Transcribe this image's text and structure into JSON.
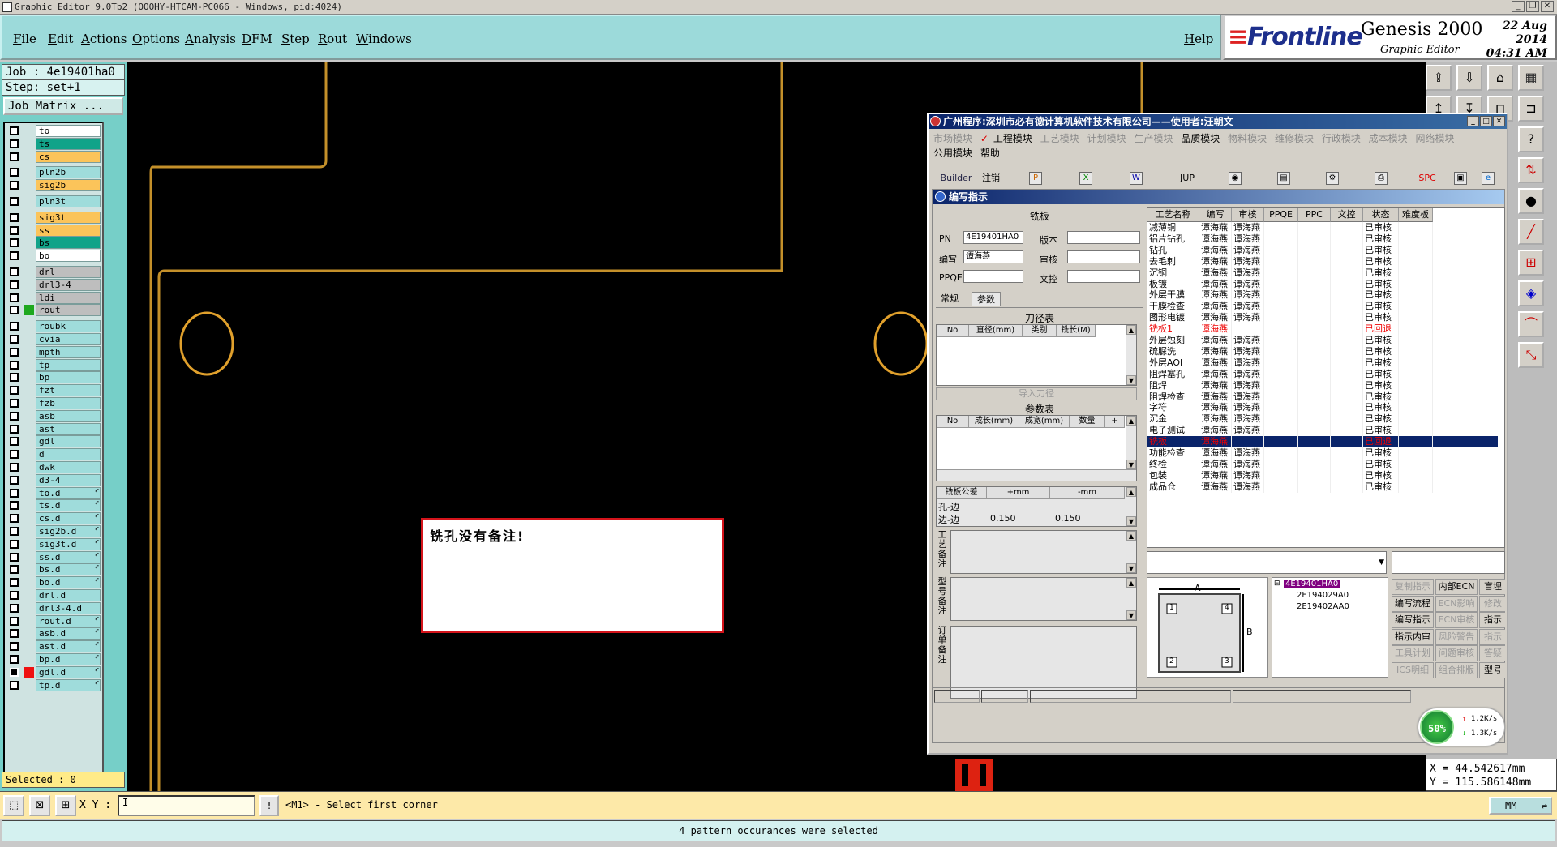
{
  "titlebar": {
    "text": "Graphic Editor 9.0Tb2 (OOOHY-HTCAM-PC066 - Windows, pid:4024)"
  },
  "menu": [
    "File",
    "Edit",
    "Actions",
    "Options",
    "Analysis",
    "DFM",
    "Step",
    "Rout",
    "Windows"
  ],
  "help": "Help",
  "brand": {
    "logo": "Frontline",
    "product": "Genesis 2000",
    "subtitle": "Graphic Editor",
    "date": "22 Aug 2014",
    "time": "04:31 AM"
  },
  "job": {
    "job": "Job : 4e19401ha0",
    "step": "Step: set+1",
    "matrix": "Job Matrix ..."
  },
  "layers": [
    {
      "name": "to",
      "color": "#ffffff"
    },
    {
      "name": "ts",
      "color": "#11a389"
    },
    {
      "name": "cs",
      "color": "#fbc45a"
    },
    {
      "name": "pln2b",
      "color": "#9fdcdb"
    },
    {
      "name": "sig2b",
      "color": "#fbc45a"
    },
    {
      "name": "pln3t",
      "color": "#9fdcdb"
    },
    {
      "name": "sig3t",
      "color": "#fbc45a"
    },
    {
      "name": "ss",
      "color": "#fbc45a"
    },
    {
      "name": "bs",
      "color": "#11a389"
    },
    {
      "name": "bo",
      "color": "#ffffff"
    },
    {
      "name": "drl",
      "color": "#bebebe"
    },
    {
      "name": "drl3-4",
      "color": "#bebebe"
    },
    {
      "name": "ldi",
      "color": "#bebebe"
    },
    {
      "name": "rout",
      "color": "#bebebe",
      "swatch": "#1ea81e"
    },
    {
      "name": "roubk",
      "color": "#9fdcdb"
    },
    {
      "name": "cvia",
      "color": "#9fdcdb"
    },
    {
      "name": "mpth",
      "color": "#9fdcdb"
    },
    {
      "name": "tp",
      "color": "#9fdcdb"
    },
    {
      "name": "bp",
      "color": "#9fdcdb"
    },
    {
      "name": "fzt",
      "color": "#9fdcdb"
    },
    {
      "name": "fzb",
      "color": "#9fdcdb"
    },
    {
      "name": "asb",
      "color": "#9fdcdb"
    },
    {
      "name": "ast",
      "color": "#9fdcdb"
    },
    {
      "name": "gdl",
      "color": "#9fdcdb"
    },
    {
      "name": "d",
      "color": "#9fdcdb"
    },
    {
      "name": "dwk",
      "color": "#9fdcdb"
    },
    {
      "name": "d3-4",
      "color": "#9fdcdb"
    },
    {
      "name": "to.d",
      "color": "#9fdcdb",
      "arrow": true
    },
    {
      "name": "ts.d",
      "color": "#9fdcdb",
      "arrow": true
    },
    {
      "name": "cs.d",
      "color": "#9fdcdb",
      "arrow": true
    },
    {
      "name": "sig2b.d",
      "color": "#9fdcdb",
      "arrow": true
    },
    {
      "name": "sig3t.d",
      "color": "#9fdcdb",
      "arrow": true
    },
    {
      "name": "ss.d",
      "color": "#9fdcdb",
      "arrow": true
    },
    {
      "name": "bs.d",
      "color": "#9fdcdb",
      "arrow": true
    },
    {
      "name": "bo.d",
      "color": "#9fdcdb",
      "arrow": true
    },
    {
      "name": "drl.d",
      "color": "#9fdcdb"
    },
    {
      "name": "drl3-4.d",
      "color": "#9fdcdb"
    },
    {
      "name": "rout.d",
      "color": "#9fdcdb",
      "arrow": true
    },
    {
      "name": "asb.d",
      "color": "#9fdcdb",
      "arrow": true
    },
    {
      "name": "ast.d",
      "color": "#9fdcdb",
      "arrow": true
    },
    {
      "name": "bp.d",
      "color": "#9fdcdb",
      "arrow": true
    },
    {
      "name": "gdl.d",
      "color": "#9fdcdb",
      "arrow": true,
      "swatch": "#e11",
      "checked": true
    },
    {
      "name": "tp.d",
      "color": "#9fdcdb",
      "arrow": true
    }
  ],
  "selected": "Selected : 0",
  "coords": {
    "x": "X = 44.542617mm",
    "y": "Y = 115.586148mm"
  },
  "status": {
    "xy_label": "X Y :",
    "prompt": "<M1> - Select first corner",
    "units": "MM",
    "message": "4 pattern occurances were selected"
  },
  "alert": {
    "text": "铣孔没有备注!"
  },
  "cnapp": {
    "title": "广州程序:深圳市必有德计算机软件技术有限公司——使用者:汪朝文",
    "modules": [
      "市场模块",
      "工程模块",
      "工艺模块",
      "计划模块",
      "生产模块",
      "品质模块",
      "物料模块",
      "维修模块",
      "行政模块",
      "成本模块",
      "网络模块"
    ],
    "modules2": [
      "公用模块",
      "帮助"
    ],
    "toolbar": [
      "Builder",
      "注销",
      "JUP",
      "SPC"
    ],
    "inner_title": "编写指示",
    "form": {
      "header": "铣板",
      "pn_label": "PN",
      "pn": "4E19401HA0",
      "version_label": "版本",
      "author_label": "编写",
      "author": "谭海燕",
      "review_label": "审核",
      "ppqe_label": "PPQE",
      "control_label": "文控",
      "tabs": [
        "常规",
        "参数"
      ],
      "tool_header": "刀径表",
      "tool_cols": [
        "No",
        "直径(mm)",
        "类别",
        "铣长(M)"
      ],
      "import_btn": "导入刀径",
      "param_header": "参数表",
      "param_cols": [
        "No",
        "成长(mm)",
        "成宽(mm)",
        "数量",
        "+"
      ],
      "tol_cols": [
        "铣板公差",
        "+mm",
        "-mm"
      ],
      "tol_rows": [
        {
          "name": "孔-边",
          "plus": "",
          "minus": ""
        },
        {
          "name": "边-边",
          "plus": "0.150",
          "minus": "0.150"
        }
      ],
      "note_labels": [
        "工艺备注",
        "型号备注",
        "订单备注"
      ]
    },
    "proc_cols": [
      "工艺名称",
      "编写",
      "审核",
      "PPQE",
      "PPC",
      "文控",
      "状态",
      "难度板"
    ],
    "proc_rows": [
      {
        "n": "减薄铜",
        "w": "谭海燕",
        "r": "谭海燕",
        "s": "已审核"
      },
      {
        "n": "铝片钻孔",
        "w": "谭海燕",
        "r": "谭海燕",
        "s": "已审核"
      },
      {
        "n": "钻孔",
        "w": "谭海燕",
        "r": "谭海燕",
        "s": "已审核"
      },
      {
        "n": "去毛刺",
        "w": "谭海燕",
        "r": "谭海燕",
        "s": "已审核"
      },
      {
        "n": "沉铜",
        "w": "谭海燕",
        "r": "谭海燕",
        "s": "已审核"
      },
      {
        "n": "板镀",
        "w": "谭海燕",
        "r": "谭海燕",
        "s": "已审核"
      },
      {
        "n": "外层干膜",
        "w": "谭海燕",
        "r": "谭海燕",
        "s": "已审核"
      },
      {
        "n": "干膜检查",
        "w": "谭海燕",
        "r": "谭海燕",
        "s": "已审核"
      },
      {
        "n": "图形电镀",
        "w": "谭海燕",
        "r": "谭海燕",
        "s": "已审核"
      },
      {
        "n": "铣板1",
        "w": "谭海燕",
        "r": "",
        "s": "已回退",
        "t": "red"
      },
      {
        "n": "外层蚀刻",
        "w": "谭海燕",
        "r": "谭海燕",
        "s": "已审核"
      },
      {
        "n": "硫脲洗",
        "w": "谭海燕",
        "r": "谭海燕",
        "s": "已审核"
      },
      {
        "n": "外层AOI",
        "w": "谭海燕",
        "r": "谭海燕",
        "s": "已审核"
      },
      {
        "n": "阻焊塞孔",
        "w": "谭海燕",
        "r": "谭海燕",
        "s": "已审核"
      },
      {
        "n": "阻焊",
        "w": "谭海燕",
        "r": "谭海燕",
        "s": "已审核"
      },
      {
        "n": "阻焊检查",
        "w": "谭海燕",
        "r": "谭海燕",
        "s": "已审核"
      },
      {
        "n": "字符",
        "w": "谭海燕",
        "r": "谭海燕",
        "s": "已审核"
      },
      {
        "n": "沉金",
        "w": "谭海燕",
        "r": "谭海燕",
        "s": "已审核"
      },
      {
        "n": "电子测试",
        "w": "谭海燕",
        "r": "谭海燕",
        "s": "已审核"
      },
      {
        "n": "铣板",
        "w": "谭海燕",
        "r": "",
        "s": "已回退",
        "t": "sel"
      },
      {
        "n": "功能检查",
        "w": "谭海燕",
        "r": "谭海燕",
        "s": "已审核"
      },
      {
        "n": "终检",
        "w": "谭海燕",
        "r": "谭海燕",
        "s": "已审核"
      },
      {
        "n": "包装",
        "w": "谭海燕",
        "r": "谭海燕",
        "s": "已审核"
      },
      {
        "n": "成品仓",
        "w": "谭海燕",
        "r": "谭海燕",
        "s": "已审核"
      }
    ],
    "diagram": {
      "a": "A",
      "b": "B",
      "n1": "1",
      "n2": "2",
      "n3": "3",
      "n4": "4"
    },
    "tree": [
      "4E19401HA0",
      "2E194029A0",
      "2E19402AA0"
    ],
    "btns": [
      [
        {
          "l": "复制指示",
          "d": true
        },
        {
          "l": "内部ECN"
        },
        {
          "l": "盲埋"
        }
      ],
      [
        {
          "l": "编写流程"
        },
        {
          "l": "ECN影响",
          "d": true
        },
        {
          "l": "修改",
          "d": true
        }
      ],
      [
        {
          "l": "编写指示"
        },
        {
          "l": "ECN审核",
          "d": true
        },
        {
          "l": "指示"
        }
      ],
      [
        {
          "l": "指示内审"
        },
        {
          "l": "风险警告",
          "d": true
        },
        {
          "l": "指示",
          "d": true
        }
      ],
      [
        {
          "l": "工具计划",
          "d": true
        },
        {
          "l": "问题审核",
          "d": true
        },
        {
          "l": "答疑",
          "d": true
        }
      ],
      [
        {
          "l": "ICS明细",
          "d": true
        },
        {
          "l": "组合排版",
          "d": true
        },
        {
          "l": "型号"
        }
      ]
    ]
  },
  "speed": {
    "pct": "50%",
    "up": "1.2K/s",
    "down": "1.3K/s"
  }
}
